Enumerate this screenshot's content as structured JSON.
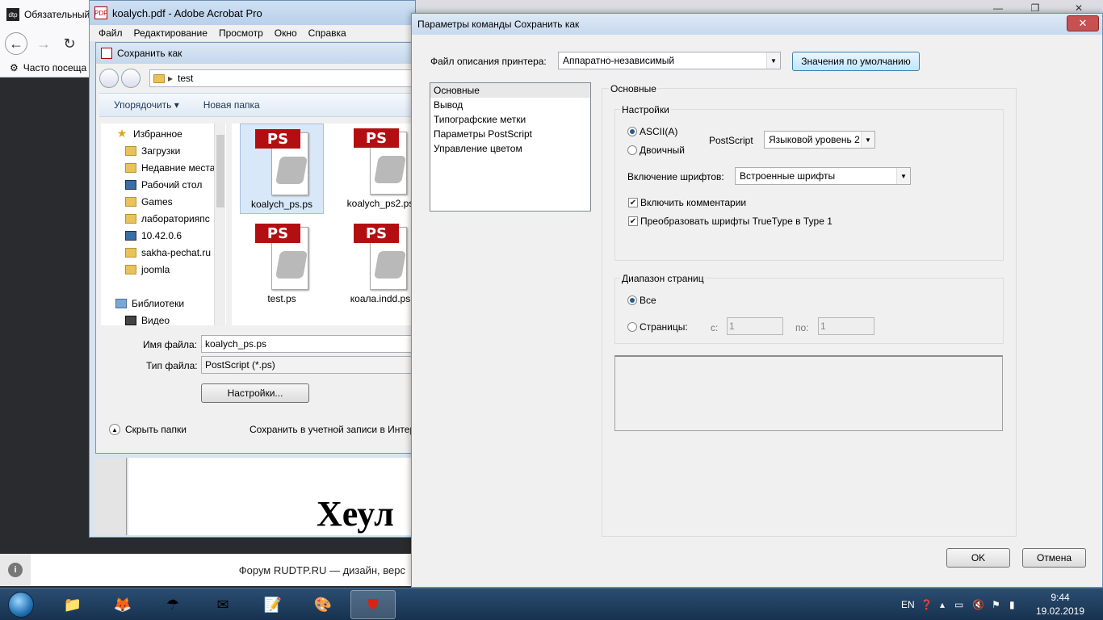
{
  "browser": {
    "tab_title": "Обязательный",
    "tab_favicon": "dtp",
    "bookmark": "Часто посеща",
    "footer_text": "Форум RUDTP.RU — дизайн, верс"
  },
  "acrobat": {
    "title": "koalych.pdf - Adobe Acrobat Pro",
    "menu": [
      "Файл",
      "Редактирование",
      "Просмотр",
      "Окно",
      "Справка"
    ],
    "doc_heading": "Хеул"
  },
  "saveas": {
    "title": "Сохранить как",
    "path": "test",
    "toolbar": {
      "organize": "Упорядочить ▾",
      "new_folder": "Новая папка"
    },
    "nav": [
      {
        "label": "Избранное",
        "icon": "star-icon",
        "header": true
      },
      {
        "label": "Загрузки",
        "icon": "folder-icon"
      },
      {
        "label": "Недавние места",
        "icon": "folder-icon"
      },
      {
        "label": "Рабочий стол",
        "icon": "desktop-icon"
      },
      {
        "label": "Games",
        "icon": "folder-icon"
      },
      {
        "label": "лабораторияпс",
        "icon": "folder-icon"
      },
      {
        "label": "10.42.0.6",
        "icon": "computer-icon"
      },
      {
        "label": "sakha-pechat.ru",
        "icon": "folder-icon"
      },
      {
        "label": "joomla",
        "icon": "folder-icon"
      },
      {
        "label": "",
        "icon": ""
      },
      {
        "label": "Библиотеки",
        "icon": "library-icon",
        "header": true
      },
      {
        "label": "Видео",
        "icon": "video-icon"
      }
    ],
    "files": [
      {
        "name": "koalych_ps.ps",
        "selected": true
      },
      {
        "name": "koalych_ps2.ps",
        "selected": false
      },
      {
        "name": "test.ps",
        "selected": false
      },
      {
        "name": "коала.indd.ps",
        "selected": false
      }
    ],
    "ps_badge": "PS",
    "filename_label": "Имя файла:",
    "filename_value": "koalych_ps.ps",
    "filetype_label": "Тип файла:",
    "filetype_value": "PostScript (*.ps)",
    "settings_button": "Настройки...",
    "hide_folders": "Скрыть папки",
    "save_in_account": "Сохранить в учетной записи в Интер"
  },
  "options": {
    "title": "Параметры команды Сохранить как",
    "close_symbol": "✕",
    "ppd_label": "Файл описания принтера:",
    "ppd_value": "Аппаратно-независимый",
    "defaults_button": "Значения по умолчанию",
    "categories": [
      "Основные",
      "Вывод",
      "Типографские метки",
      "Параметры PostScript",
      "Управление цветом"
    ],
    "panel_title": "Основные",
    "settings_group": "Настройки",
    "ascii": "ASCII(A)",
    "binary": "Двоичный",
    "postscript_label": "PostScript",
    "postscript_value": "Языковой уровень 2",
    "fonts_label": "Включение шрифтов:",
    "fonts_value": "Встроенные шрифты",
    "include_comments": "Включить комментарии",
    "convert_truetype": "Преобразовать шрифты TrueType в Type 1",
    "range_group": "Диапазон страниц",
    "all": "Все",
    "pages": "Страницы:",
    "from_label": "с:",
    "from_value": "1",
    "to_label": "по:",
    "to_value": "1",
    "ok": "OK",
    "cancel": "Отмена"
  },
  "taskbar": {
    "lang": "EN",
    "time": "9:44",
    "date": "19.02.2019"
  }
}
